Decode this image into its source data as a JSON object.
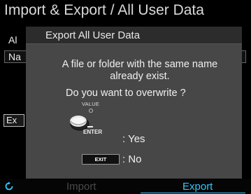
{
  "header": {
    "title": "Import & Export / All User Data"
  },
  "background": {
    "row_all_label": "Al",
    "row_name_label": "Na",
    "exec_button_label": "Ex"
  },
  "dialog": {
    "title": "Export All User Data",
    "message_line1": "A file or folder with the same name",
    "message_line2": "already exist.",
    "question": "Do you want to overwrite ?",
    "value_knob_label": "VALUE",
    "enter_label": "ENTER",
    "yes_text": ": Yes",
    "exit_key_label": "EXIT",
    "no_text": ": No"
  },
  "tabbar": {
    "back_icon": "refresh-icon",
    "tabs": [
      {
        "label": "Import",
        "active": false
      },
      {
        "label": "Export",
        "active": true
      }
    ],
    "accent_color": "#2fc8ff"
  }
}
